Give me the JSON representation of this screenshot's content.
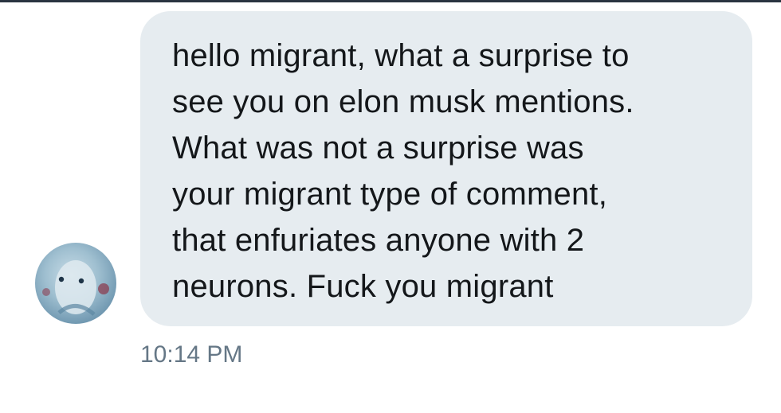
{
  "message": {
    "text": "hello migrant, what a surprise to\nsee you on elon musk mentions.\nWhat was not a surprise was\nyour migrant type of comment,\nthat enfuriates anyone with 2\nneurons. Fuck you migrant",
    "timestamp": "10:14 PM"
  },
  "colors": {
    "bubble_background": "#e6ecf0",
    "text": "#14171a",
    "timestamp": "#657786"
  },
  "icons": {
    "avatar": "profile-avatar"
  }
}
